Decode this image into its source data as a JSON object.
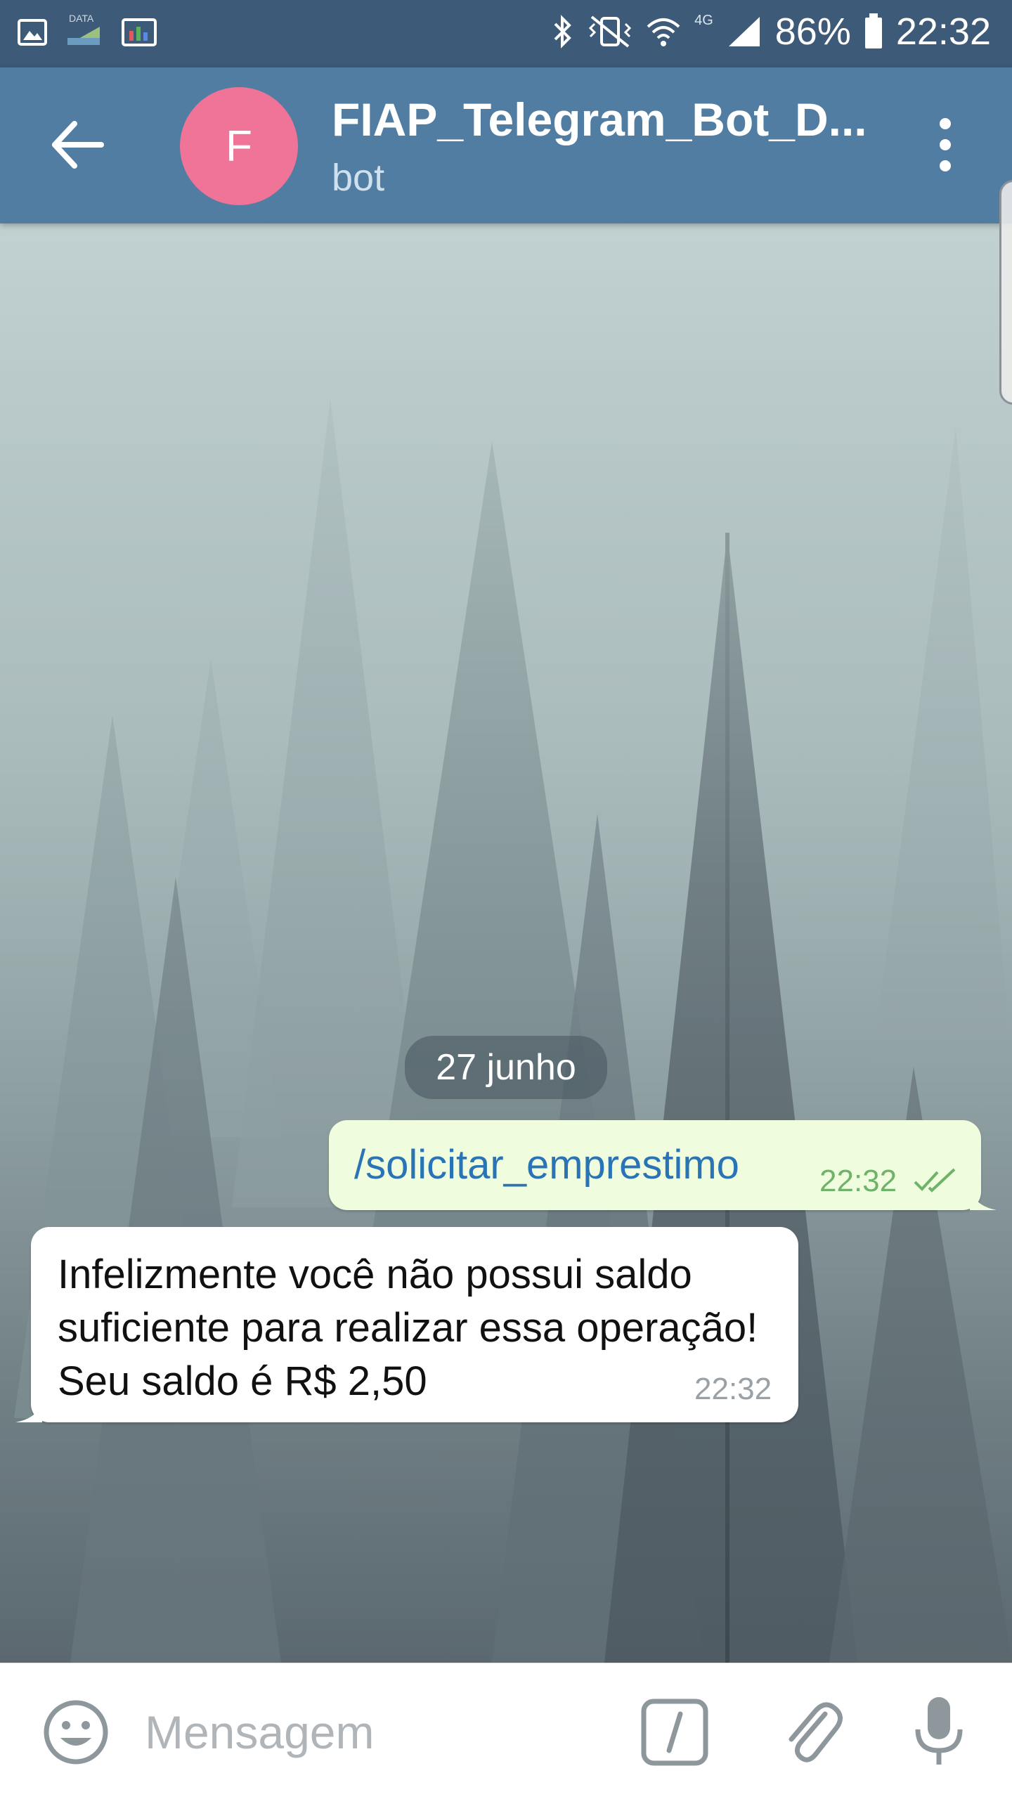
{
  "status_bar": {
    "time": "22:32",
    "battery_text": "86%",
    "network_label": "4G",
    "data_label": "DATA",
    "icons": [
      "gallery-icon",
      "data-icon",
      "screen-icon",
      "bluetooth-icon",
      "mute-vibrate-icon",
      "wifi-icon",
      "signal-icon",
      "battery-icon"
    ]
  },
  "header": {
    "avatar_letter": "F",
    "avatar_color": "#f07497",
    "title": "FIAP_Telegram_Bot_D...",
    "subtitle": "bot",
    "bar_color": "#527da3"
  },
  "chat": {
    "date_label": "27 junho",
    "messages": [
      {
        "direction": "out",
        "text": "/solicitar_emprestimo",
        "time": "22:32",
        "status": "read"
      },
      {
        "direction": "in",
        "text": "Infelizmente você não possui saldo suficiente para realizar essa operação! Seu saldo é R$ 2,50",
        "time": "22:32"
      }
    ]
  },
  "composer": {
    "placeholder": "Mensagem"
  }
}
